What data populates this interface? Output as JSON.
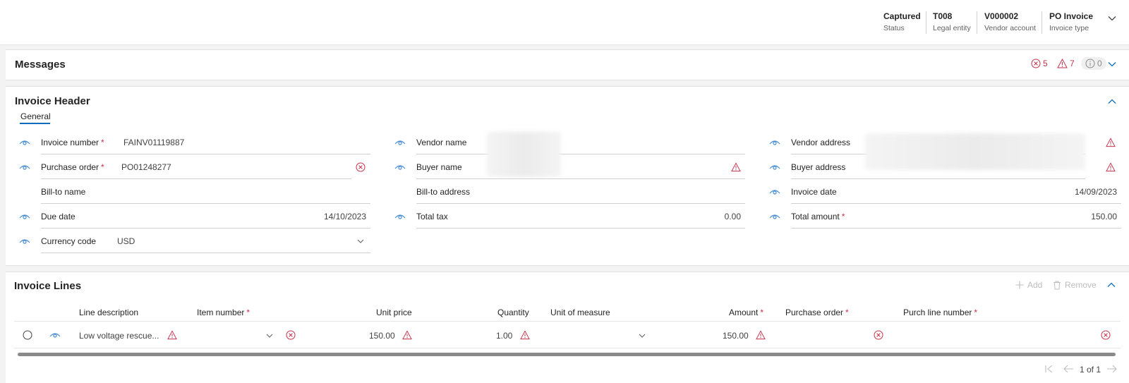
{
  "header": {
    "status": {
      "value": "Captured",
      "label": "Status"
    },
    "legal_entity": {
      "value": "T008",
      "label": "Legal entity"
    },
    "vendor_account": {
      "value": "V000002",
      "label": "Vendor account"
    },
    "invoice_type": {
      "value": "PO Invoice",
      "label": "Invoice type"
    }
  },
  "messages": {
    "title": "Messages",
    "error_count": "5",
    "warning_count": "7",
    "info_count": "0"
  },
  "invoice_header": {
    "title": "Invoice Header",
    "tab": "General",
    "fields": {
      "invoice_number": {
        "label": "Invoice number",
        "value": "FAINV01119887",
        "required": "*"
      },
      "purchase_order": {
        "label": "Purchase order",
        "value": "PO01248277",
        "required": "*"
      },
      "bill_to_name": {
        "label": "Bill-to name",
        "value": ""
      },
      "due_date": {
        "label": "Due date",
        "value": "14/10/2023"
      },
      "currency_code": {
        "label": "Currency code",
        "value": "USD"
      },
      "vendor_name": {
        "label": "Vendor name",
        "value": ""
      },
      "buyer_name": {
        "label": "Buyer name",
        "value": ""
      },
      "bill_to_address": {
        "label": "Bill-to address",
        "value": ""
      },
      "total_tax": {
        "label": "Total tax",
        "value": "0.00"
      },
      "vendor_address": {
        "label": "Vendor address",
        "value": ""
      },
      "buyer_address": {
        "label": "Buyer address",
        "value": ""
      },
      "invoice_date": {
        "label": "Invoice date",
        "value": "14/09/2023"
      },
      "total_amount": {
        "label": "Total amount",
        "value": "150.00",
        "required": "*"
      }
    }
  },
  "invoice_lines": {
    "title": "Invoice Lines",
    "add_label": "Add",
    "remove_label": "Remove",
    "columns": {
      "line_description": "Line description",
      "item_number": "Item number",
      "unit_price": "Unit price",
      "quantity": "Quantity",
      "unit_of_measure": "Unit of measure",
      "amount": "Amount",
      "purchase_order": "Purchase order",
      "purch_line_number": "Purch line number",
      "required": "*"
    },
    "rows": [
      {
        "line_description": "Low voltage rescue...",
        "item_number": "",
        "unit_price": "150.00",
        "quantity": "1.00",
        "unit_of_measure": "",
        "amount": "150.00",
        "purchase_order": "",
        "purch_line_number": ""
      }
    ],
    "pager": "1 of 1"
  },
  "colors": {
    "accent": "#0f6cbd",
    "error": "#c4314b",
    "eye": "#4a8fd4"
  }
}
